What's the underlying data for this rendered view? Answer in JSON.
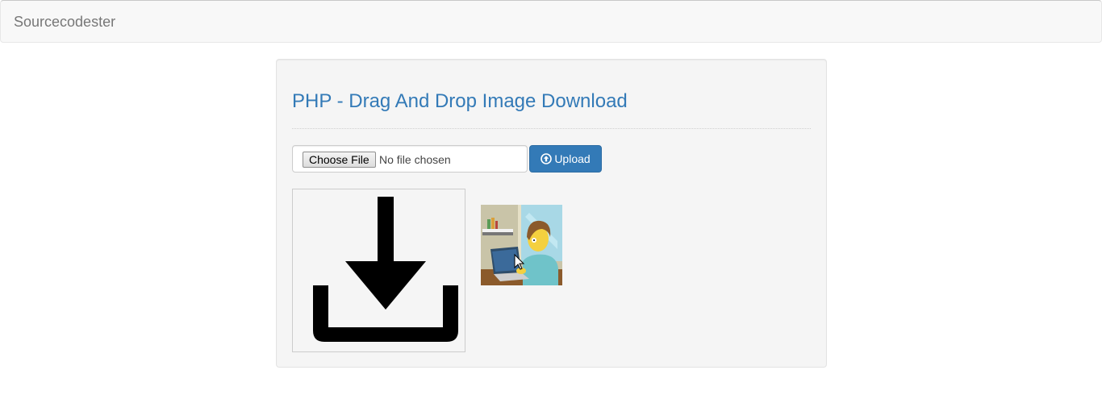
{
  "navbar": {
    "brand": "Sourcecodester"
  },
  "main": {
    "title": "PHP - Drag And Drop Image Download",
    "file_input": {
      "button_label": "Choose File",
      "status": "No file chosen"
    },
    "upload_button": {
      "label": "Upload",
      "icon": "circle-arrow-up-icon"
    },
    "dropzone": {
      "icon": "download-icon"
    },
    "thumbnail": {
      "description_icon": "cartoon-user-laptop-image"
    }
  },
  "colors": {
    "accent": "#337ab7",
    "navbar_bg": "#f8f8f8",
    "well_bg": "#f5f5f5",
    "brand_text": "#777777"
  }
}
